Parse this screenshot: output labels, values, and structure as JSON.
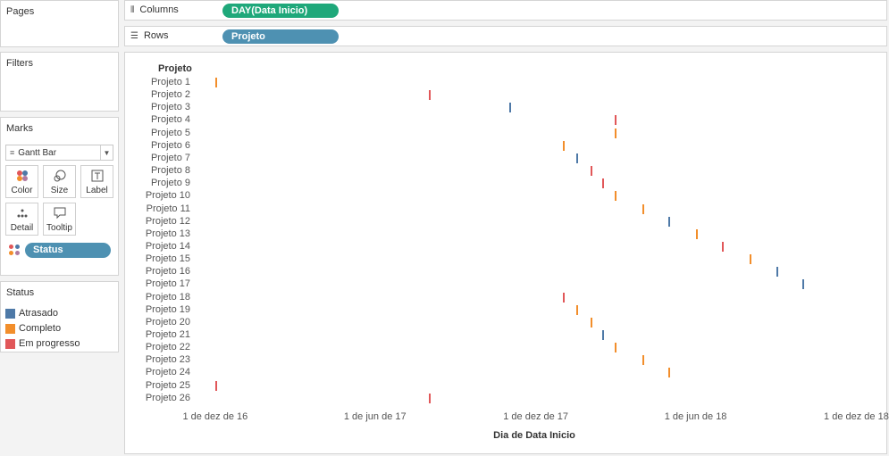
{
  "left_pane": {
    "pages_title": "Pages",
    "filters_title": "Filters",
    "marks_title": "Marks",
    "mark_type": "Gantt Bar",
    "mark_buttons": [
      "Color",
      "Size",
      "Label",
      "Detail",
      "Tooltip"
    ],
    "color_pill": "Status",
    "legend_title": "Status"
  },
  "shelves": {
    "columns_label": "Columns",
    "columns_pill": "DAY(Data Inicio)",
    "rows_label": "Rows",
    "rows_pill": "Projeto"
  },
  "colors": {
    "columns_pill": "#1fa87a",
    "rows_pill": "#4e91b2",
    "Atrasado": "#4e79a7",
    "Completo": "#f28e2b",
    "Em progresso": "#e15759"
  },
  "chart_data": {
    "type": "gantt",
    "row_header": "Projeto",
    "xlabel": "Dia de Data Inicio",
    "x_ticks": [
      "1 de dez de 16",
      "1 de jun de 17",
      "1 de dez de 17",
      "1 de jun de 18",
      "1 de dez de 18"
    ],
    "xlim": [
      "2016-11-22",
      "2018-12-28"
    ],
    "legend": [
      "Atrasado",
      "Completo",
      "Em progresso"
    ],
    "rows": [
      {
        "label": "Projeto 1",
        "date": "2016-12-01",
        "status": "Completo"
      },
      {
        "label": "Projeto 2",
        "date": "2017-08-01",
        "status": "Em progresso"
      },
      {
        "label": "Projeto 3",
        "date": "2017-11-01",
        "status": "Atrasado"
      },
      {
        "label": "Projeto 4",
        "date": "2018-03-01",
        "status": "Em progresso"
      },
      {
        "label": "Projeto 5",
        "date": "2018-03-01",
        "status": "Completo"
      },
      {
        "label": "Projeto 6",
        "date": "2018-01-01",
        "status": "Completo"
      },
      {
        "label": "Projeto 7",
        "date": "2018-01-16",
        "status": "Atrasado"
      },
      {
        "label": "Projeto 8",
        "date": "2018-02-01",
        "status": "Em progresso"
      },
      {
        "label": "Projeto 9",
        "date": "2018-02-15",
        "status": "Em progresso"
      },
      {
        "label": "Projeto 10",
        "date": "2018-03-01",
        "status": "Completo"
      },
      {
        "label": "Projeto 11",
        "date": "2018-04-01",
        "status": "Completo"
      },
      {
        "label": "Projeto 12",
        "date": "2018-05-01",
        "status": "Atrasado"
      },
      {
        "label": "Projeto 13",
        "date": "2018-06-01",
        "status": "Completo"
      },
      {
        "label": "Projeto 14",
        "date": "2018-07-01",
        "status": "Em progresso"
      },
      {
        "label": "Projeto 15",
        "date": "2018-08-01",
        "status": "Completo"
      },
      {
        "label": "Projeto 16",
        "date": "2018-09-01",
        "status": "Atrasado"
      },
      {
        "label": "Projeto 17",
        "date": "2018-10-01",
        "status": "Atrasado"
      },
      {
        "label": "Projeto 18",
        "date": "2018-01-01",
        "status": "Em progresso"
      },
      {
        "label": "Projeto 19",
        "date": "2018-01-16",
        "status": "Completo"
      },
      {
        "label": "Projeto 20",
        "date": "2018-02-01",
        "status": "Completo"
      },
      {
        "label": "Projeto 21",
        "date": "2018-02-15",
        "status": "Atrasado"
      },
      {
        "label": "Projeto 22",
        "date": "2018-03-01",
        "status": "Completo"
      },
      {
        "label": "Projeto 23",
        "date": "2018-04-01",
        "status": "Completo"
      },
      {
        "label": "Projeto 24",
        "date": "2018-05-01",
        "status": "Completo"
      },
      {
        "label": "Projeto 25",
        "date": "2016-12-01",
        "status": "Em progresso"
      },
      {
        "label": "Projeto 26",
        "date": "2017-08-01",
        "status": "Em progresso"
      }
    ]
  }
}
